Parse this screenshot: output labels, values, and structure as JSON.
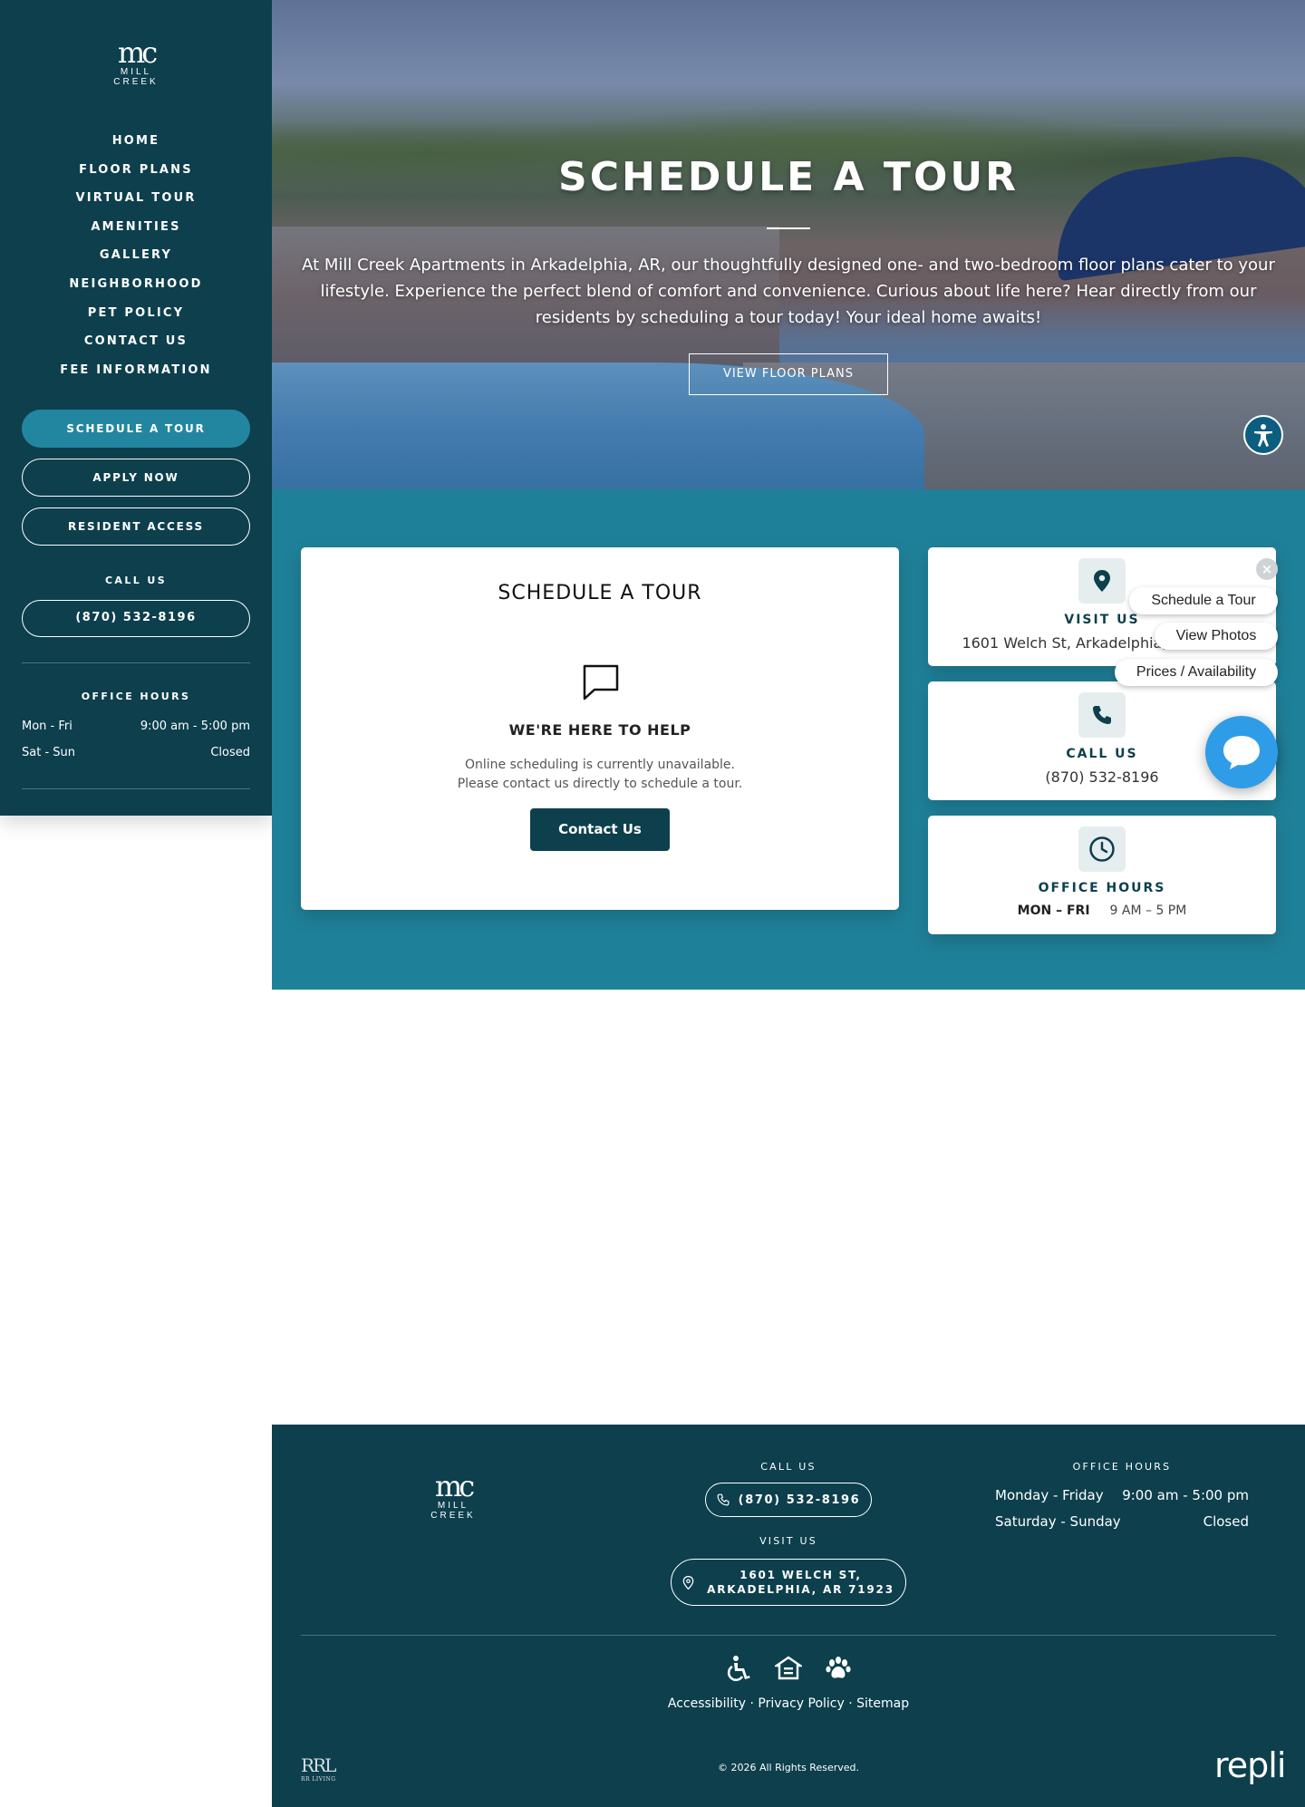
{
  "sidebar": {
    "logo": {
      "mono": "mc",
      "line1": "MILL",
      "line2": "CREEK"
    },
    "nav": [
      {
        "label": "HOME"
      },
      {
        "label": "FLOOR PLANS"
      },
      {
        "label": "VIRTUAL TOUR"
      },
      {
        "label": "AMENITIES"
      },
      {
        "label": "GALLERY"
      },
      {
        "label": "NEIGHBORHOOD"
      },
      {
        "label": "PET POLICY"
      },
      {
        "label": "CONTACT US"
      },
      {
        "label": "FEE INFORMATION"
      }
    ],
    "schedule_tour": "SCHEDULE A TOUR",
    "apply_now": "APPLY NOW",
    "resident_access": "RESIDENT ACCESS",
    "call_label": "CALL US",
    "phone": "(870) 532-8196",
    "hours_label": "OFFICE HOURS",
    "hours": [
      {
        "day": "Mon - Fri",
        "time": "9:00 am - 5:00 pm"
      },
      {
        "day": "Sat - Sun",
        "time": "Closed"
      }
    ]
  },
  "hero": {
    "title": "SCHEDULE A TOUR",
    "text": "At Mill Creek Apartments in Arkadelphia, AR, our thoughtfully designed one- and two-bedroom floor plans cater to your lifestyle. Experience the perfect blend of comfort and convenience. Curious about life here? Hear directly from our residents by scheduling a tour today! Your ideal home awaits!",
    "button": "VIEW FLOOR PLANS"
  },
  "tour_card": {
    "title": "SCHEDULE A TOUR",
    "heading": "WE'RE HERE TO HELP",
    "line1": "Online scheduling is currently unavailable.",
    "line2": "Please contact us directly to schedule a tour.",
    "button": "Contact Us"
  },
  "info_cards": {
    "visit": {
      "label": "VISIT US",
      "value": "1601 Welch St, Arkadelphia, AR 71923"
    },
    "call": {
      "label": "CALL US",
      "value": "(870) 532-8196"
    },
    "hours": {
      "label": "OFFICE HOURS",
      "days": "MON – FRI",
      "time": "9 AM – 5 PM"
    }
  },
  "widget": {
    "schedule": "Schedule a Tour",
    "photos": "View Photos",
    "prices": "Prices / Availability",
    "close": "×"
  },
  "footer": {
    "logo": {
      "mono": "mc",
      "line1": "MILL",
      "line2": "CREEK"
    },
    "call_label": "CALL US",
    "phone": "(870) 532-8196",
    "visit_label": "VISIT US",
    "address_line1": "1601 WELCH ST,",
    "address_line2": "ARKADELPHIA, AR 71923",
    "hours_label": "OFFICE HOURS",
    "hours": [
      {
        "day": "Monday - Friday",
        "time": "9:00 am - 5:00 pm"
      },
      {
        "day": "Saturday - Sunday",
        "time": "Closed"
      }
    ],
    "links": {
      "accessibility": "Accessibility",
      "privacy": "Privacy Policy",
      "sitemap": "Sitemap",
      "sep": "·"
    },
    "copyright": "© 2026 All Rights Reserved.",
    "rrl": "RRL",
    "rrl_sub": "RR LIVING",
    "repli": "repli"
  },
  "colors": {
    "sidebar": "#0d3f4d",
    "accent": "#2386a0",
    "teal": "#1f8199",
    "chat": "#2f9ce8"
  }
}
